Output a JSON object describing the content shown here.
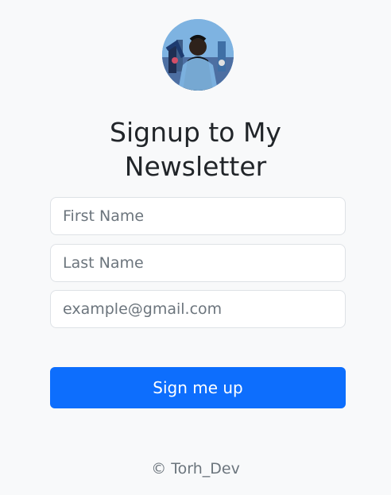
{
  "title": "Signup to My Newsletter",
  "form": {
    "first_name_placeholder": "First Name",
    "last_name_placeholder": "Last Name",
    "email_placeholder": "example@gmail.com",
    "submit_label": "Sign me up"
  },
  "footer": {
    "text": "© Torh_Dev"
  },
  "colors": {
    "background": "#f8f9fa",
    "primary_button": "#0d6efd",
    "text": "#212529",
    "muted_text": "#6c757d",
    "input_border": "#dee2e6"
  },
  "icons": {
    "avatar": "profile-photo"
  }
}
